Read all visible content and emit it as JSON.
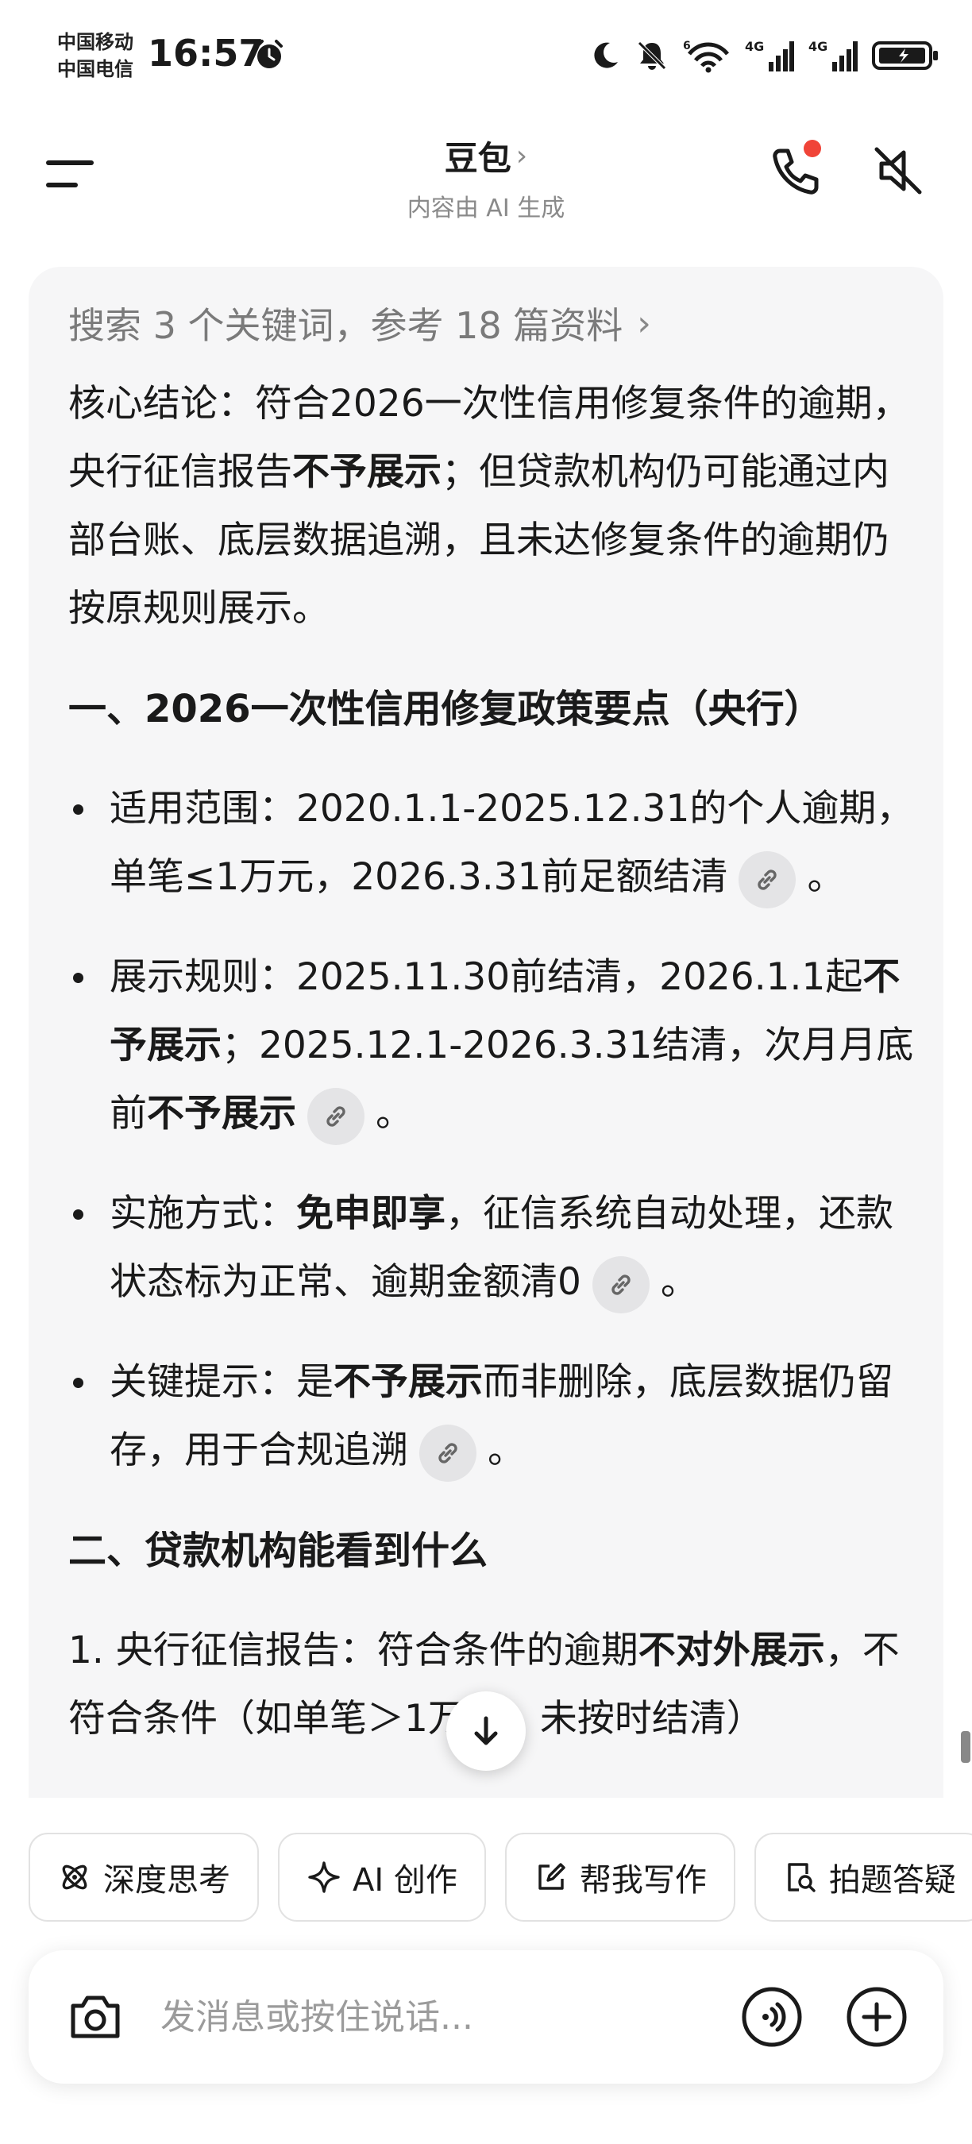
{
  "status_bar": {
    "carrier_1": "中国移动",
    "carrier_2": "中国电信",
    "time": "16:57",
    "signal_1_label": "4G",
    "signal_2_label": "4G",
    "wifi_label": "6"
  },
  "header": {
    "title": "豆包",
    "chevron": "›",
    "subtitle": "内容由 AI 生成"
  },
  "answer": {
    "search_summary": "搜索 3 个关键词，参考 18 篇资料",
    "conclusion": {
      "prefix": "核心结论：符合2026一次性信用修复条件的逾期，央行征信报告",
      "bold": "不予展示",
      "suffix": "；但贷款机构仍可能通过内部台账、底层数据追溯，且未达修复条件的逾期仍按原规则展示。"
    },
    "section_1_title": "一、2026一次性信用修复政策要点（央行）",
    "bullets": [
      {
        "text_1": "适用范围：2020.1.1-2025.12.31的个人逾期，单笔≤1万元，2026.3.31前足额结清",
        "end": "。"
      },
      {
        "text_1": "展示规则：2025.11.30前结清，2026.1.1起",
        "bold_1": "不予展示",
        "text_2": "；2025.12.1-2026.3.31结清，次月月底前",
        "bold_2": "不予展示",
        "end": "。"
      },
      {
        "text_1": "实施方式：",
        "bold_1": "免申即享",
        "text_2": "，征信系统自动处理，还款状态标为正常、逾期金额清0",
        "end": "。"
      },
      {
        "text_1": "关键提示：是",
        "bold_1": "不予展示",
        "text_2": "而非删除，底层数据仍留存，用于合规追溯",
        "end": "。"
      }
    ],
    "section_2_title": "二、贷款机构能看到什么",
    "numbered_1": {
      "text": "1. 央行征信报告：符合条件的逾期",
      "bold": "不对外展示",
      "text_2": "，不符合条件（如单笔＞1万元、未按时结清）"
    }
  },
  "quick_actions": [
    {
      "label": "深度思考",
      "icon": "atom-icon"
    },
    {
      "label": "AI 创作",
      "icon": "sparkle-icon"
    },
    {
      "label": "帮我写作",
      "icon": "edit-icon"
    },
    {
      "label": "拍题答疑",
      "icon": "search-doc-icon"
    }
  ],
  "composer": {
    "placeholder": "发消息或按住说话..."
  },
  "colors": {
    "accent_red": "#f04438",
    "card_bg": "#f6f6f7",
    "muted_text": "#8a8a8a"
  }
}
